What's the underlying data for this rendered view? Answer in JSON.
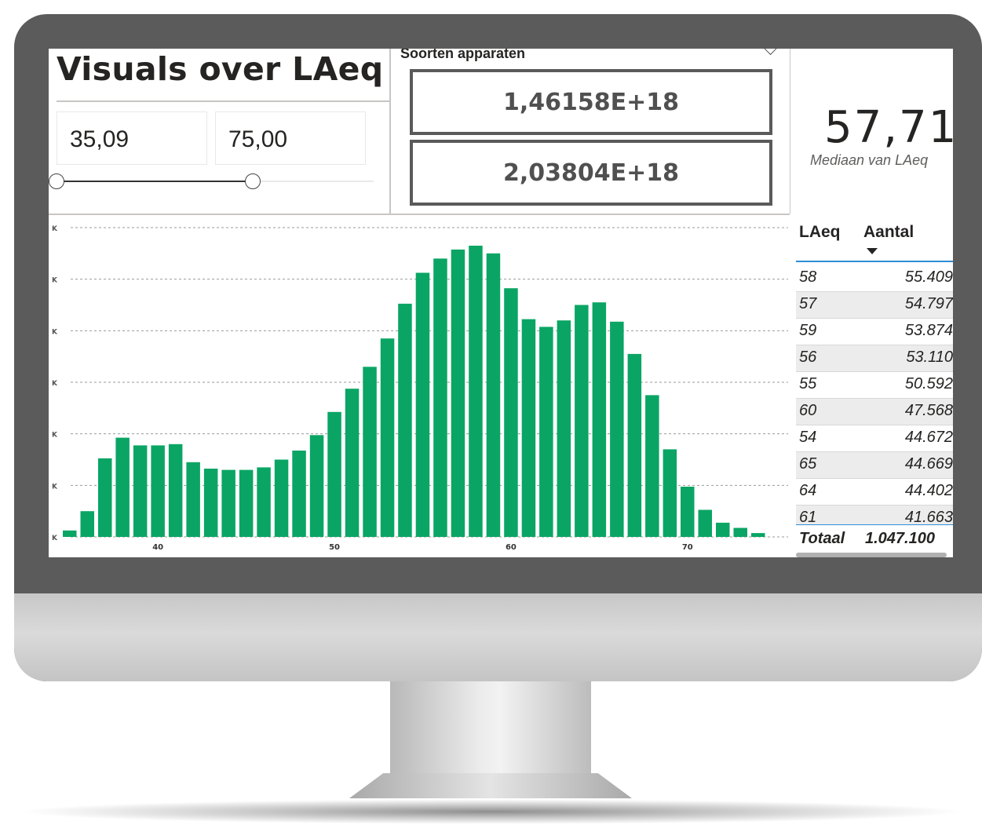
{
  "report": {
    "title": "Visuals over LAeq",
    "range_slicer": {
      "min_value": "35,09",
      "max_value": "75,00",
      "min_handle_fraction": 0.0,
      "max_handle_fraction": 0.62
    },
    "device_slicer": {
      "label": "Soorten apparaten",
      "cards": [
        "1,46158E+18",
        "2,03804E+18"
      ]
    },
    "kpi": {
      "value": "57,71",
      "label": "Mediaan van LAeq"
    }
  },
  "chart_data": {
    "type": "bar",
    "x": [
      35,
      36,
      37,
      38,
      39,
      40,
      41,
      42,
      43,
      44,
      45,
      46,
      47,
      48,
      49,
      50,
      51,
      52,
      53,
      54,
      55,
      56,
      57,
      58,
      59,
      60,
      61,
      62,
      63,
      64,
      65,
      66,
      67,
      68,
      69,
      70,
      71,
      72,
      73,
      74
    ],
    "values": [
      2.5,
      10,
      30.5,
      38.5,
      35.5,
      35.5,
      36,
      29,
      26.5,
      26,
      26,
      27,
      30,
      33.5,
      39.5,
      48.5,
      57.5,
      66,
      77,
      90.5,
      102.5,
      108,
      111.5,
      113,
      110,
      96.5,
      84.5,
      81.5,
      84,
      90,
      91,
      83.5,
      71,
      55,
      34,
      19.5,
      10.5,
      5.5,
      3.5,
      1.5
    ],
    "x_ticks": [
      "40",
      "50",
      "60",
      "70"
    ],
    "x_tick_values": [
      40,
      50,
      60,
      70
    ],
    "y_tick_labels": [
      "K",
      "K",
      "K",
      "K",
      "K",
      "K",
      "K"
    ],
    "ylim": [
      0,
      120
    ],
    "grid": true,
    "bar_color": "#0aa564"
  },
  "table": {
    "headers": [
      "LAeq",
      "Aantal"
    ],
    "rows": [
      [
        "58",
        "55.409"
      ],
      [
        "57",
        "54.797"
      ],
      [
        "59",
        "53.874"
      ],
      [
        "56",
        "53.110"
      ],
      [
        "55",
        "50.592"
      ],
      [
        "60",
        "47.568"
      ],
      [
        "54",
        "44.672"
      ],
      [
        "65",
        "44.669"
      ],
      [
        "64",
        "44.402"
      ],
      [
        "61",
        "41.663"
      ]
    ],
    "total_label": "Totaal",
    "total_value": "1.047.100"
  }
}
